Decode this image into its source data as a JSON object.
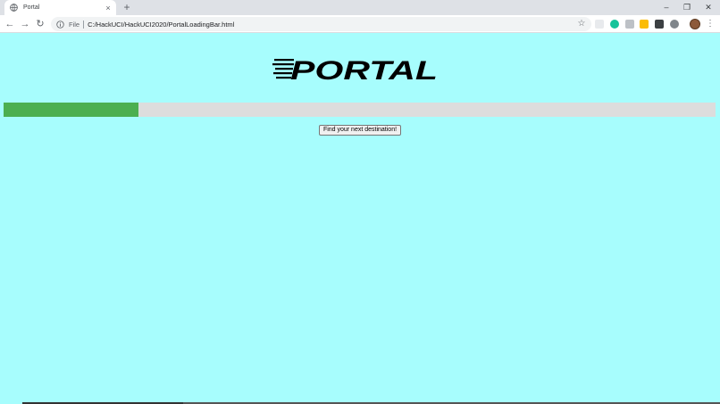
{
  "browser": {
    "tab": {
      "title": "Portal",
      "close_glyph": "×",
      "favicon": "globe-icon"
    },
    "new_tab_glyph": "+",
    "window_controls": {
      "minimize": "–",
      "restore": "❐",
      "close": "✕"
    },
    "nav": {
      "back": "←",
      "forward": "→",
      "reload": "↻"
    },
    "omnibox": {
      "scheme_label": "File",
      "url": "C:/HackUCI/HackUCI2020/PortalLoadingBar.html",
      "star_glyph": "☆"
    },
    "extensions": [
      {
        "name": "extension-icon-1",
        "color": "#e8eaed"
      },
      {
        "name": "grammarly-icon",
        "color": "#15c39a"
      },
      {
        "name": "extension-icon-3",
        "color": "#bdc1c6"
      },
      {
        "name": "extension-icon-4",
        "color": "#fbbc04"
      },
      {
        "name": "extension-icon-5",
        "color": "#3c4043"
      },
      {
        "name": "extension-icon-6",
        "color": "#80868b"
      }
    ],
    "menu_glyph": "⋮"
  },
  "page": {
    "background": "#a7fdfd",
    "logo_text": "PORTAL",
    "progress": {
      "fraction": 0.19,
      "fill_color": "#4caf50",
      "track_color": "#dddddd"
    },
    "button_label": "Find your next destination!"
  }
}
